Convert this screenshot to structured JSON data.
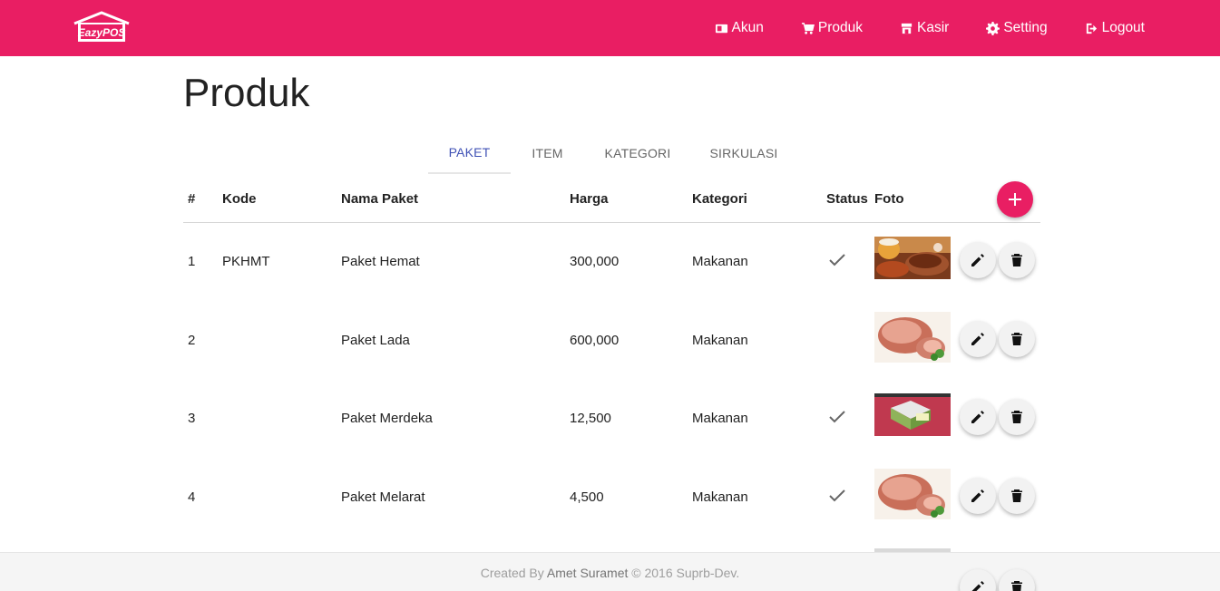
{
  "app": {
    "logo_text": "EazyPOS",
    "accent_color": "#e91e63",
    "tab_active_color": "#3f51b5"
  },
  "nav": {
    "items": [
      {
        "label": "Akun",
        "icon": "id-card-icon"
      },
      {
        "label": "Produk",
        "icon": "cart-icon"
      },
      {
        "label": "Kasir",
        "icon": "store-icon"
      },
      {
        "label": "Setting",
        "icon": "gear-icon"
      },
      {
        "label": "Logout",
        "icon": "logout-icon"
      }
    ]
  },
  "page": {
    "title": "Produk"
  },
  "tabs": [
    {
      "label": "PAKET",
      "active": true
    },
    {
      "label": "ITEM",
      "active": false
    },
    {
      "label": "KATEGORI",
      "active": false
    },
    {
      "label": "SIRKULASI",
      "active": false
    }
  ],
  "table": {
    "headers": [
      "#",
      "Kode",
      "Nama Paket",
      "Harga",
      "Kategori",
      "Status",
      "Foto"
    ],
    "rows": [
      {
        "no": "1",
        "kode": "PKHMT",
        "nama": "Paket Hemat",
        "harga": "300,000",
        "kategori": "Makanan",
        "status": true,
        "foto": "food-platter"
      },
      {
        "no": "2",
        "kode": "",
        "nama": "Paket Lada",
        "harga": "600,000",
        "kategori": "Makanan",
        "status": false,
        "foto": "ham-roast"
      },
      {
        "no": "3",
        "kode": "",
        "nama": "Paket Merdeka",
        "harga": "12,500",
        "kategori": "Makanan",
        "status": true,
        "foto": "red-promo"
      },
      {
        "no": "4",
        "kode": "",
        "nama": "Paket Melarat",
        "harga": "4,500",
        "kategori": "Makanan",
        "status": true,
        "foto": "ham-roast"
      }
    ]
  },
  "footer": {
    "prefix": "Created By",
    "author": "Amet Suramet",
    "suffix": "© 2016 Suprb-Dev."
  }
}
